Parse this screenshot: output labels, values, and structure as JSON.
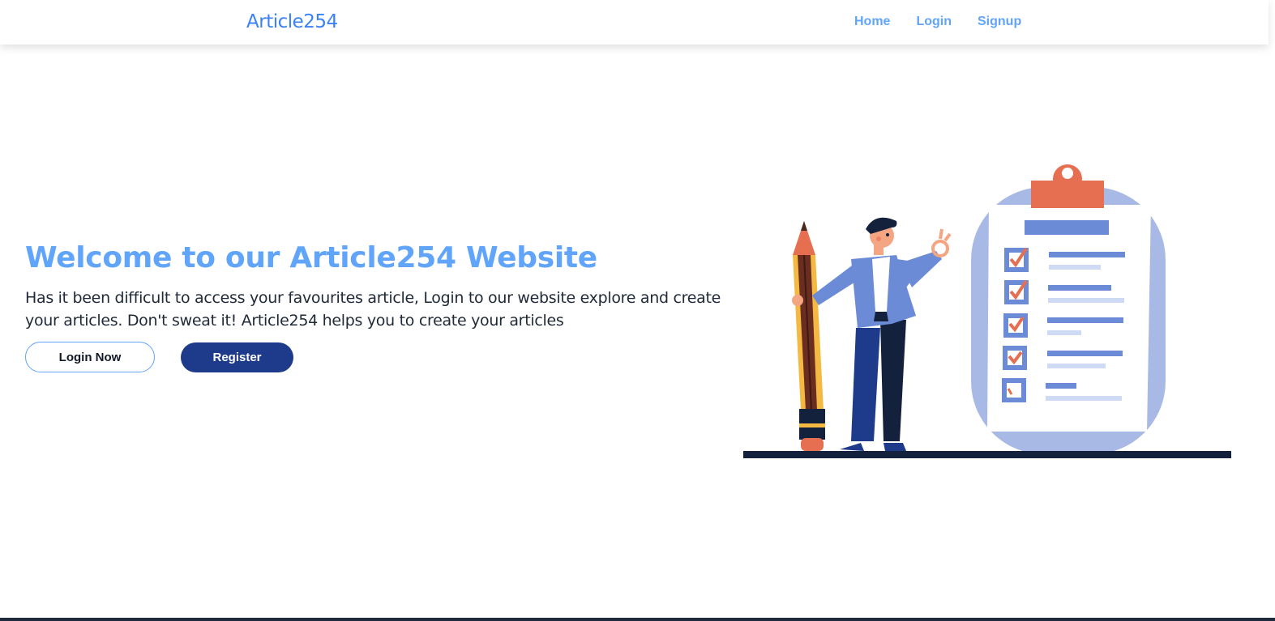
{
  "navbar": {
    "brand": "Article254",
    "links": [
      "Home",
      "Login",
      "Signup"
    ]
  },
  "hero": {
    "title": "Welcome to our Article254 Website",
    "description": "Has it been difficult to access your favourites article, Login to our website explore and create your articles. Don't sweat it! Article254 helps you to create your articles",
    "login_button": "Login Now",
    "register_button": "Register"
  },
  "colors": {
    "accent": "#60a5fa",
    "brand": "#3b82f6",
    "primary_dark": "#1e3a8a",
    "illustration_orange": "#e76f51",
    "illustration_blue": "#6b8bd6"
  },
  "icons": {
    "illustration": "man-with-pencil-and-checklist-illustration"
  }
}
